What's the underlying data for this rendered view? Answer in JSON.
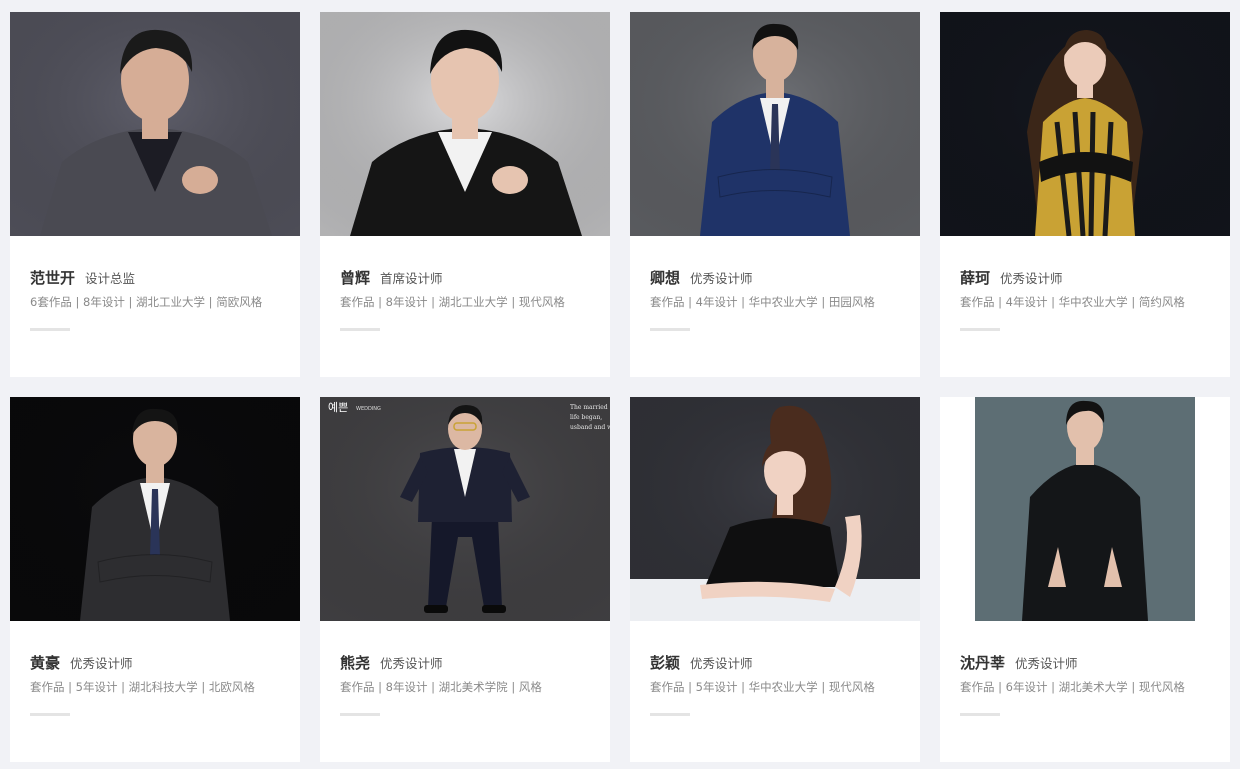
{
  "designers": [
    {
      "name": "范世开",
      "title": "设计总监",
      "meta": "6套作品 | 8年设计 | 湖北工业大学 | 简欧风格",
      "photo": {
        "bg": "#5f5f6b",
        "suit": "#4a4a52",
        "shirt": "#1c1c24",
        "hair": "#1a1a1a",
        "skin": "#d6ad96",
        "pose": "closeup"
      }
    },
    {
      "name": "曾辉",
      "title": "首席设计师",
      "meta": "套作品 | 8年设计 | 湖北工业大学 | 现代风格",
      "photo": {
        "bg": "#dcdcde",
        "suit": "#151515",
        "shirt": "#f2f2f2",
        "hair": "#121212",
        "skin": "#e6c4b0",
        "pose": "closeup"
      }
    },
    {
      "name": "卿想",
      "title": "优秀设计师",
      "meta": "套作品 | 4年设计 | 华中农业大学 | 田园风格",
      "photo": {
        "bg": "#6e7075",
        "suit": "#1f3368",
        "shirt": "#f1f1f1",
        "hair": "#111111",
        "skin": "#d7b29c",
        "pose": "half"
      }
    },
    {
      "name": "薛珂",
      "title": "优秀设计师",
      "meta": "套作品 | 4年设计 | 华中农业大学 | 简约风格",
      "photo": {
        "bg": "#151820",
        "suit": "#c9a234",
        "shirt": "#141414",
        "hair": "#3b2618",
        "skin": "#ebcbb9",
        "pose": "female"
      }
    },
    {
      "name": "黄豪",
      "title": "优秀设计师",
      "meta": "套作品 | 5年设计 | 湖北科技大学 | 北欧风格",
      "photo": {
        "bg": "#0b0b0d",
        "suit": "#2d2d30",
        "shirt": "#f2f2f2",
        "hair": "#141414",
        "skin": "#d9b49e",
        "pose": "half"
      }
    },
    {
      "name": "熊尧",
      "title": "优秀设计师",
      "meta": "套作品 | 8年设计 | 湖北美术学院 | 风格",
      "photo": {
        "bg": "#4d4c4f",
        "suit": "#1e2133",
        "shirt": "#f2f2f2",
        "hair": "#141414",
        "skin": "#dcb8a3",
        "pose": "full"
      }
    },
    {
      "name": "彭颖",
      "title": "优秀设计师",
      "meta": "套作品 | 5年设计 | 华中农业大学 | 现代风格",
      "photo": {
        "bg": "#3a3b42",
        "suit": "#0f0f10",
        "shirt": "#0f0f10",
        "hair": "#4a2c1e",
        "skin": "#f0d2c3",
        "pose": "desk"
      }
    },
    {
      "name": "沈丹莘",
      "title": "优秀设计师",
      "meta": "套作品 | 6年设计 | 湖北美术大学 | 现代风格",
      "photo": {
        "bg": "#5d6e74",
        "suit": "#141618",
        "shirt": "#141618",
        "hair": "#121212",
        "skin": "#e2c0ac",
        "pose": "narrow"
      }
    }
  ],
  "photo_overlay": {
    "brand": "예쁜",
    "brand_small": "WEDDING",
    "script": "The married life began, husband and wife"
  }
}
